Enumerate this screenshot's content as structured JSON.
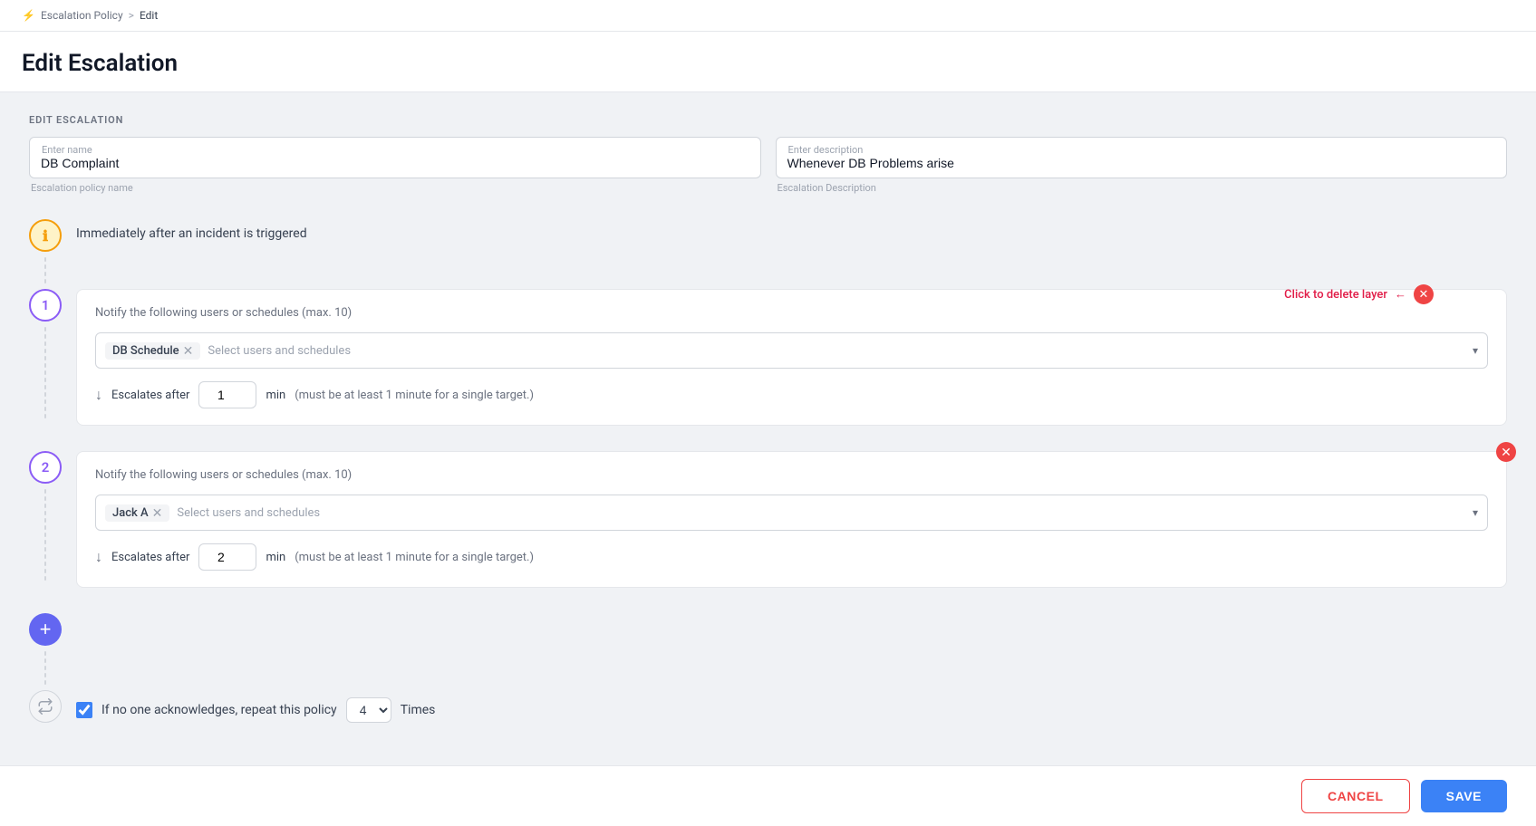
{
  "breadcrumb": {
    "icon": "⚡",
    "parent": "Escalation Policy",
    "separator": ">",
    "current": "Edit"
  },
  "page": {
    "title": "Edit Escalation",
    "section_label": "EDIT ESCALATION"
  },
  "form": {
    "name_label": "Enter name",
    "name_value": "DB Complaint",
    "name_hint": "Escalation policy name",
    "desc_label": "Enter description",
    "desc_value": "Whenever DB Problems arise",
    "desc_hint": "Escalation Description"
  },
  "trigger": {
    "label": "Immediately after an incident is triggered"
  },
  "layers": [
    {
      "number": "1",
      "title": "Notify the following users or schedules (max. 10)",
      "tag": "DB Schedule",
      "placeholder": "Select users and schedules",
      "escalates_label": "Escalates after",
      "escalates_value": "1",
      "escalates_unit": "min",
      "escalates_hint": "(must be at least 1 minute for a single target.)"
    },
    {
      "number": "2",
      "title": "Notify the following users or schedules (max. 10)",
      "tag": "Jack A",
      "placeholder": "Select users and schedules",
      "escalates_label": "Escalates after",
      "escalates_value": "2",
      "escalates_unit": "min",
      "escalates_hint": "(must be at least 1 minute for a single target.)"
    }
  ],
  "add_layer": {
    "icon": "+"
  },
  "repeat": {
    "checkbox_checked": true,
    "label": "If no one acknowledges, repeat this policy",
    "value": "4",
    "times_label": "Times"
  },
  "annotation": {
    "text": "Click to delete layer"
  },
  "footer": {
    "cancel_label": "CANCEL",
    "save_label": "SAVE"
  }
}
